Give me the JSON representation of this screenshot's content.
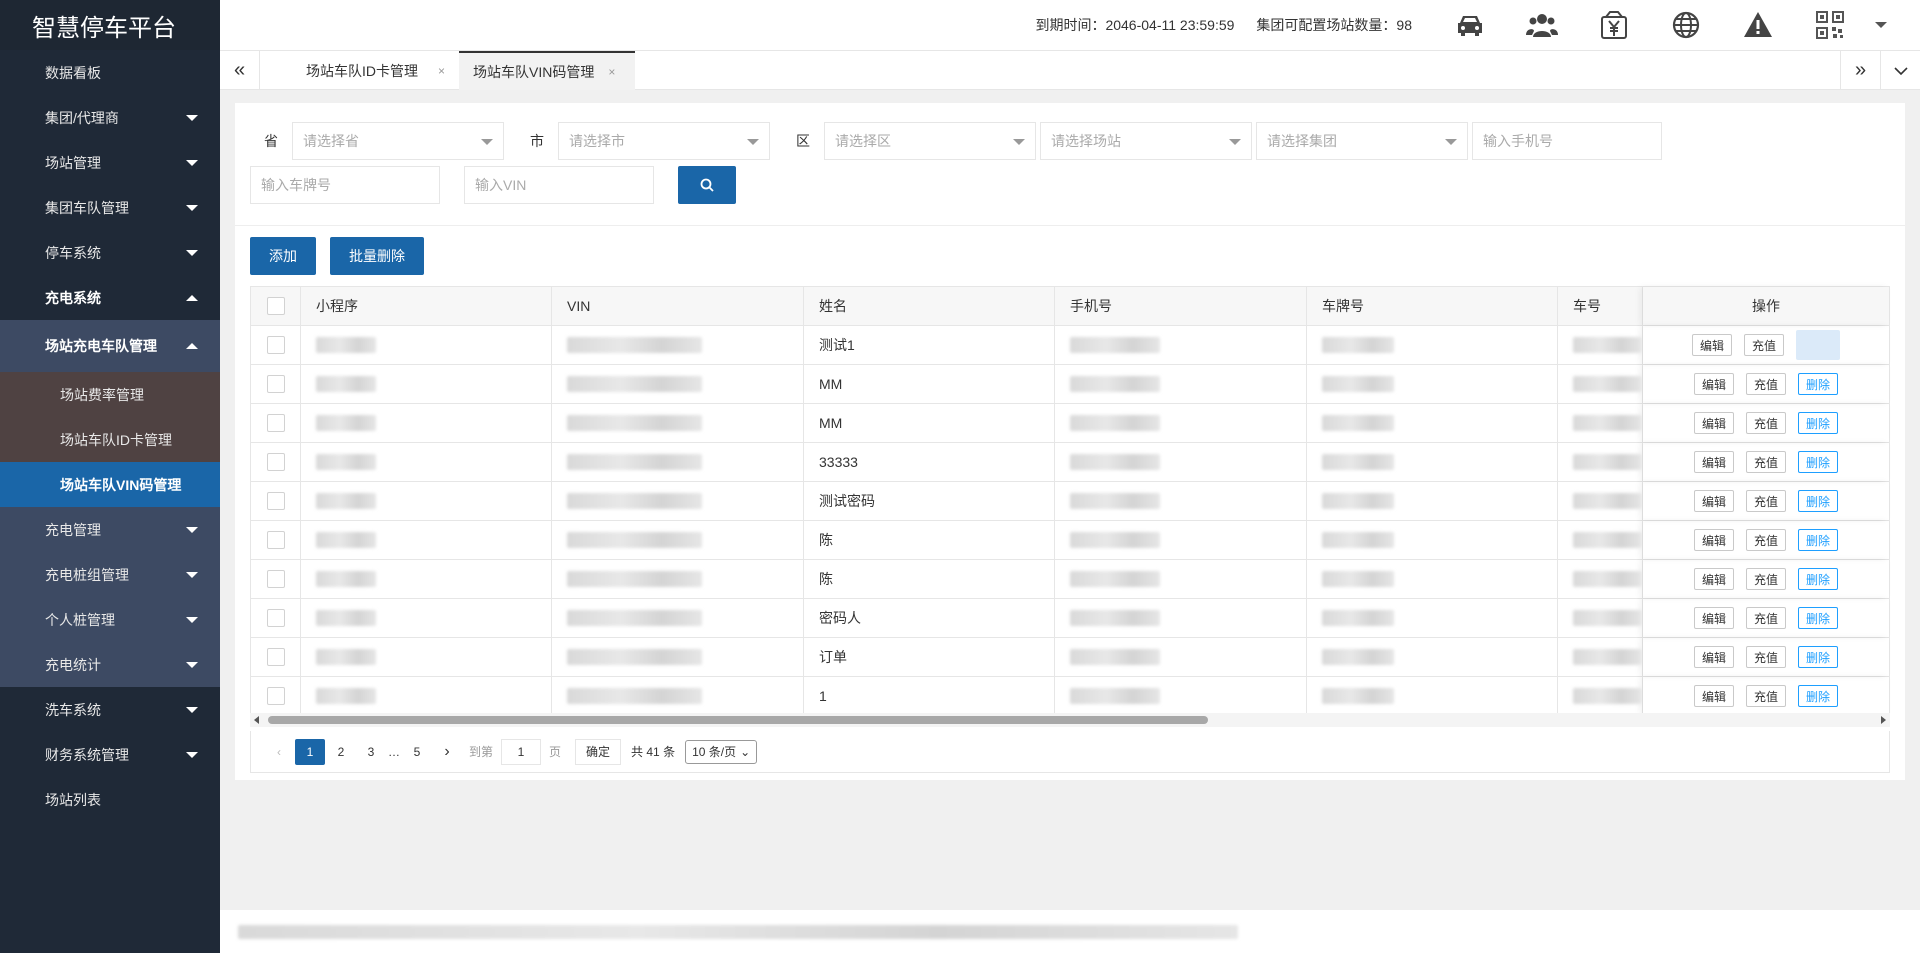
{
  "app": {
    "title": "智慧停车平台"
  },
  "sidebar": {
    "items": [
      {
        "label": "数据看板"
      },
      {
        "label": "集团/代理商"
      },
      {
        "label": "场站管理"
      },
      {
        "label": "集团车队管理"
      },
      {
        "label": "停车系统"
      },
      {
        "label": "充电系统"
      },
      {
        "label": "场站充电车队管理"
      },
      {
        "label": "场站费率管理"
      },
      {
        "label": "场站车队ID卡管理"
      },
      {
        "label": "场站车队VIN码管理"
      },
      {
        "label": "充电管理"
      },
      {
        "label": "充电桩组管理"
      },
      {
        "label": "个人桩管理"
      },
      {
        "label": "充电统计"
      },
      {
        "label": "洗车系统"
      },
      {
        "label": "财务系统管理"
      },
      {
        "label": "场站列表"
      }
    ]
  },
  "header": {
    "expire_text": "到期时间：2046-04-11 23:59:59",
    "config_text": "集团可配置场站数量：98",
    "icons": [
      "car-icon",
      "users-icon",
      "yuan-icon",
      "globe-icon",
      "warning-icon",
      "qrcode-icon"
    ]
  },
  "tabs": [
    {
      "label": "场站车队ID卡管理",
      "close": "×"
    },
    {
      "label": "场站车队VIN码管理",
      "close": "×"
    }
  ],
  "filters": {
    "province_label": "省",
    "province_placeholder": "请选择省",
    "city_label": "市",
    "city_placeholder": "请选择市",
    "district_label": "区",
    "district_placeholder": "请选择区",
    "station_placeholder": "请选择场站",
    "group_placeholder": "请选择集团",
    "phone_placeholder": "输入手机号",
    "plate_placeholder": "输入车牌号",
    "vin_placeholder": "输入VIN"
  },
  "actions": {
    "add_label": "添加",
    "batch_delete_label": "批量删除"
  },
  "table": {
    "headers": {
      "app": "小程序",
      "vin": "VIN",
      "name": "姓名",
      "phone": "手机号",
      "plate": "车牌号",
      "no": "车号",
      "op": "操作"
    },
    "op_labels": {
      "edit": "编辑",
      "recharge": "充值",
      "delete": "删除"
    },
    "rows": [
      {
        "name": "测试1"
      },
      {
        "name": "MM"
      },
      {
        "name": "MM"
      },
      {
        "name": "33333"
      },
      {
        "name": "测试密码"
      },
      {
        "name": "陈"
      },
      {
        "name": "陈"
      },
      {
        "name": "密码人"
      },
      {
        "name": "订单"
      },
      {
        "name": "1"
      }
    ]
  },
  "pager": {
    "pages": [
      "1",
      "2",
      "3",
      "…",
      "5"
    ],
    "goto_label": "到第",
    "goto_value": "1",
    "page_unit": "页",
    "confirm_label": "确定",
    "total_text": "共 41 条",
    "page_size": "10 条/页"
  }
}
